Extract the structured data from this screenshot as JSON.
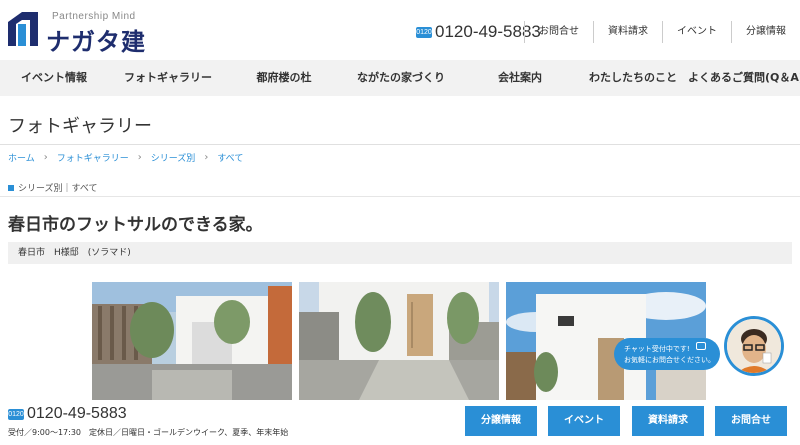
{
  "header": {
    "logo_tagline": "Partnership Mind",
    "logo_name": "ナガタ建設",
    "freedial_label": "0120",
    "phone": "0120-49-5883",
    "top_links": [
      "お問合せ",
      "資料請求",
      "イベント",
      "分譲情報"
    ]
  },
  "nav": {
    "items": [
      "イベント情報",
      "フォトギャラリー",
      "都府楼の杜",
      "ながたの家づくり",
      "会社案内",
      "わたしたちのこと",
      "よくあるご質問(Q＆A)"
    ]
  },
  "page": {
    "title": "フォトギャラリー",
    "breadcrumb": [
      "ホーム",
      "フォトギャラリー",
      "シリーズ別",
      "すべて"
    ],
    "category": "シリーズ別｜すべて",
    "house_title": "春日市のフットサルのできる家。",
    "house_info": "春日市　H様邸　(ソラマド)"
  },
  "photos": [
    {
      "name": "photo-1"
    },
    {
      "name": "photo-2"
    },
    {
      "name": "photo-3"
    }
  ],
  "chat": {
    "line1": "チャット受付中です!",
    "line2": "お気軽にお問合せください。"
  },
  "footer": {
    "phone": "0120-49-5883",
    "hours": "受付／9:00〜17:30　定休日／日曜日・ゴールデンウイーク、夏季、年末年始",
    "cta_buttons": [
      "分譲情報",
      "イベント",
      "資料請求",
      "お問合せ"
    ]
  },
  "colors": {
    "accent": "#2a8fd6",
    "logo": "#1e2d6e",
    "nav_bg": "#f2f2f2"
  }
}
